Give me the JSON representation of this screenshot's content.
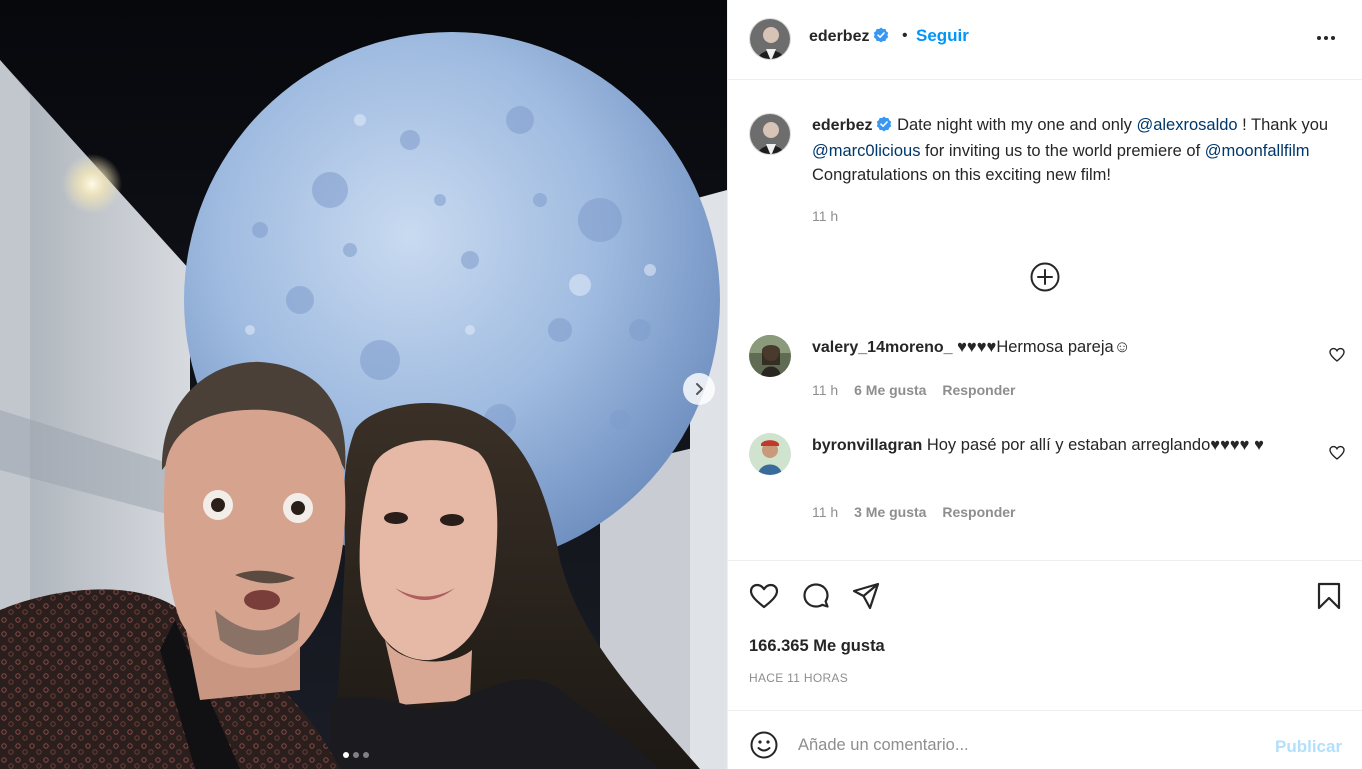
{
  "post": {
    "username": "ederbez",
    "verified": true,
    "follow_label": "Seguir",
    "separator": "•",
    "more_icon": "more-horizontal-icon"
  },
  "caption": {
    "username": "ederbez",
    "parts": [
      {
        "type": "text",
        "value": "Date night with my one and only "
      },
      {
        "type": "mention",
        "value": "@alexrosaldo"
      },
      {
        "type": "text",
        "value": " ! Thank you "
      },
      {
        "type": "mention",
        "value": "@marc0licious"
      },
      {
        "type": "text",
        "value": " for inviting us to the world premiere of "
      },
      {
        "type": "mention",
        "value": "@moonfallfilm"
      },
      {
        "type": "text",
        "value": " Congratulations on this exciting new film!"
      }
    ],
    "time": "11 h"
  },
  "load_more_icon": "plus-circle-icon",
  "comments": [
    {
      "username": "valery_14moreno_",
      "hearts": "♥♥♥♥",
      "text": "Hermosa pareja☺",
      "time": "11 h",
      "likes": "6 Me gusta",
      "reply": "Responder"
    },
    {
      "username": "byronvillagran",
      "text": "Hoy pasé por allí y estaban arreglando",
      "hearts": "♥♥♥♥",
      "hearts2": "♥",
      "time": "11 h",
      "likes": "3 Me gusta",
      "reply": "Responder"
    }
  ],
  "actions": {
    "like_icon": "heart-icon",
    "comment_icon": "comment-icon",
    "share_icon": "send-icon",
    "save_icon": "bookmark-icon"
  },
  "likes_count": "166.365 Me gusta",
  "time_ago": "HACE 11 HORAS",
  "composer": {
    "placeholder": "Añade un comentario...",
    "publish_label": "Publicar",
    "emoji_icon": "emoji-icon"
  },
  "carousel": {
    "current": 1,
    "total": 3
  },
  "colors": {
    "accent": "#0095f6",
    "publish_disabled": "#b2dffc",
    "mention": "#00376b",
    "muted": "#8e8e8e",
    "verified": "#3897f0"
  }
}
